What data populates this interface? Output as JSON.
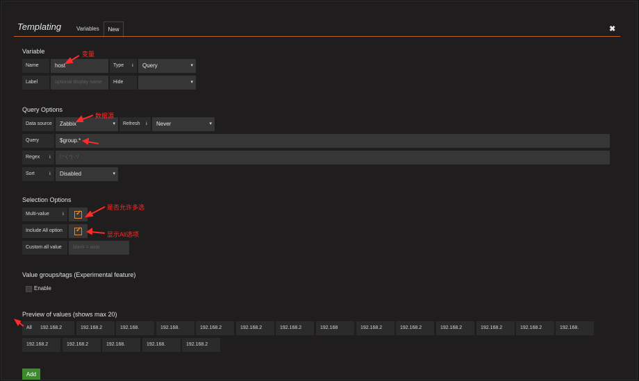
{
  "header": {
    "title": "Templating",
    "tab_variables": "Variables",
    "tab_new": "New",
    "close_glyph": "✖"
  },
  "variable": {
    "section": "Variable",
    "name_label": "Name",
    "name_value": "host",
    "type_label": "Type",
    "type_value": "Query",
    "label_label": "Label",
    "label_placeholder": "optional display name",
    "hide_label": "Hide",
    "hide_value": ""
  },
  "query_options": {
    "section": "Query Options",
    "datasource_label": "Data source",
    "datasource_value": "Zabbix",
    "refresh_label": "Refresh",
    "refresh_value": "Never",
    "query_label": "Query",
    "query_value": "$group.*",
    "regex_label": "Regex",
    "regex_placeholder": "/.*-(.*)-.*/",
    "sort_label": "Sort",
    "sort_value": "Disabled"
  },
  "selection_options": {
    "section": "Selection Options",
    "multi_label": "Multi-value",
    "include_all_label": "Include All option",
    "custom_all_label": "Custom all value",
    "custom_all_placeholder": "blank = auto"
  },
  "value_groups": {
    "section": "Value groups/tags (Experimental feature)",
    "enable_label": "Enable"
  },
  "preview": {
    "section": "Preview of values (shows max 20)",
    "values_row1": [
      "All",
      "192.168.2",
      "192.168.2",
      "192.168.",
      "192.168.",
      "192.168.2",
      "192.168.2",
      "192.168.2",
      "192.168",
      "192.168.2",
      "192.168.2",
      "192.168.2",
      "192.168.2",
      "192.168.2",
      "192.168."
    ],
    "values_row2": [
      "192.168.2",
      "192.168.2",
      "192.168.",
      "192.168.",
      "192.168.2"
    ]
  },
  "add_button": "Add",
  "annotations": {
    "variable": "变量",
    "datasource": "数据源",
    "multi_value": "是否允许多选",
    "include_all": "显示All选项"
  },
  "colors": {
    "accent": "#c0642a",
    "annotation": "#ff2b2b",
    "add_button": "#3d8a2c",
    "checkbox": "#e68a2e"
  }
}
